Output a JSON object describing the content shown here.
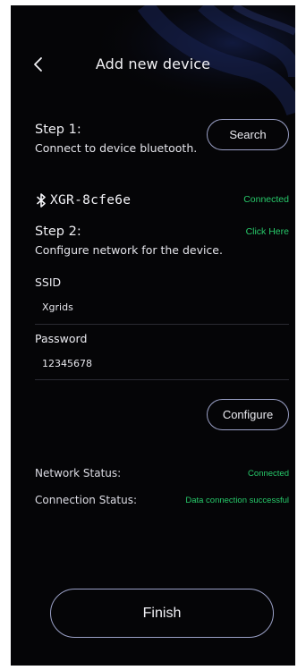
{
  "header": {
    "title": "Add new device",
    "back_icon": "chevron-left-icon"
  },
  "step1": {
    "title": "Step 1:",
    "description": "Connect to device bluetooth.",
    "search_label": "Search"
  },
  "device": {
    "name": "XGR-8cfe6e",
    "icon": "bluetooth-icon",
    "status": "Connected"
  },
  "step2": {
    "title": "Step 2:",
    "description": "Configure network for the device.",
    "link_label": "Click Here"
  },
  "form": {
    "ssid_label": "SSID",
    "ssid_value": "Xgrids",
    "password_label": "Password",
    "password_value": "12345678",
    "configure_label": "Configure"
  },
  "status": {
    "network_label": "Network Status:",
    "network_value": "Connected",
    "connection_label": "Connection Status:",
    "connection_value": "Data connection successful"
  },
  "finish_label": "Finish",
  "colors": {
    "background": "#050507",
    "accent_green": "#27c96a",
    "pill_border": "#9aa0c6"
  }
}
